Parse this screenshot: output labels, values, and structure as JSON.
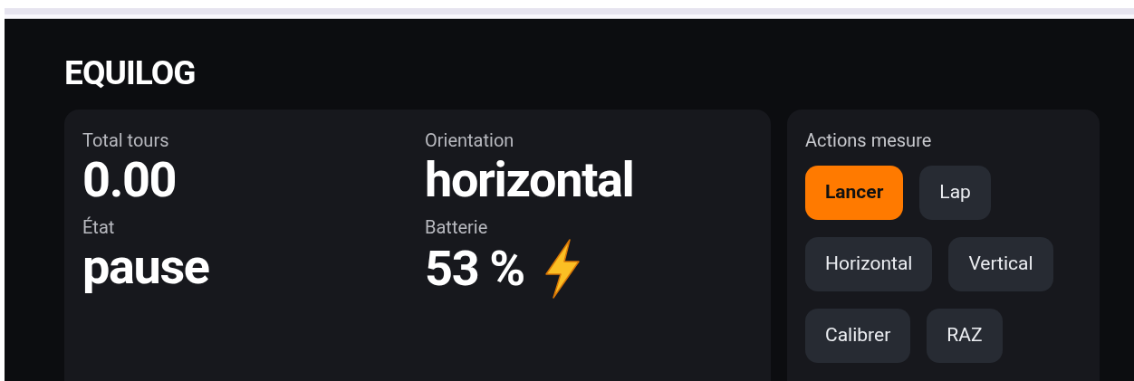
{
  "app_title": "EQUILOG",
  "stats": [
    {
      "label": "Total tours",
      "value": "0.00"
    },
    {
      "label": "Orientation",
      "value": "horizontal"
    },
    {
      "label": "État",
      "value": "pause"
    },
    {
      "label": "Batterie",
      "value": "53 %",
      "charging": true
    }
  ],
  "actions": {
    "title": "Actions mesure",
    "buttons": [
      {
        "label": "Lancer",
        "selected": true
      },
      {
        "label": "Lap",
        "selected": false
      },
      {
        "label": "Horizontal",
        "selected": false
      },
      {
        "label": "Vertical",
        "selected": false
      },
      {
        "label": "Calibrer",
        "selected": false
      },
      {
        "label": "RAZ",
        "selected": false
      }
    ]
  }
}
